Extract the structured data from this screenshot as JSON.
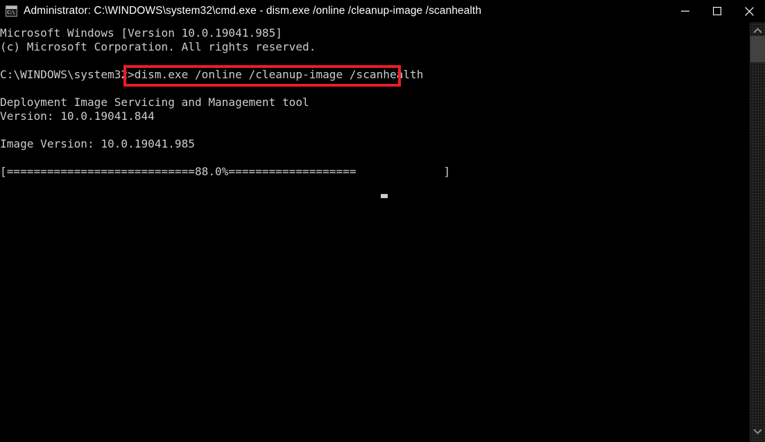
{
  "window": {
    "title": "Administrator: C:\\WINDOWS\\system32\\cmd.exe - dism.exe  /online /cleanup-image /scanhealth",
    "icon": "cmd-console-icon",
    "icon_glyph": "C:\\",
    "background_color": "#000000",
    "text_color": "#cccccc"
  },
  "titlebar_buttons": {
    "minimize_label": "—",
    "maximize_label": "☐",
    "close_label": "✕"
  },
  "console": {
    "lines": [
      "Microsoft Windows [Version 10.0.19041.985]",
      "(c) Microsoft Corporation. All rights reserved.",
      "",
      "C:\\WINDOWS\\system32>dism.exe /online /cleanup-image /scanhealth",
      "",
      "Deployment Image Servicing and Management tool",
      "Version: 10.0.19041.844",
      "",
      "Image Version: 10.0.19041.985",
      "",
      "[============================88.0%===================             ]"
    ],
    "prompt": "C:\\WINDOWS\\system32>",
    "command": "dism.exe /online /cleanup-image /scanhealth",
    "tool_name": "Deployment Image Servicing and Management tool",
    "tool_version": "Version: 10.0.19041.844",
    "image_version": "Image Version: 10.0.19041.985",
    "os_banner": "Microsoft Windows [Version 10.0.19041.985]",
    "copyright": "(c) Microsoft Corporation. All rights reserved.",
    "progress_percent": "88.0%",
    "progress_bar": "[============================88.0%===================             ]",
    "cursor": "block-cursor"
  },
  "annotation": {
    "type": "highlight-rectangle",
    "color": "#ee1c23",
    "target_text": "dism.exe /online /cleanup-image /scanhealth"
  },
  "scrollbar": {
    "up_arrow": "chevron-up-icon",
    "down_arrow": "chevron-down-icon",
    "thumb": "scrollbar-thumb"
  }
}
